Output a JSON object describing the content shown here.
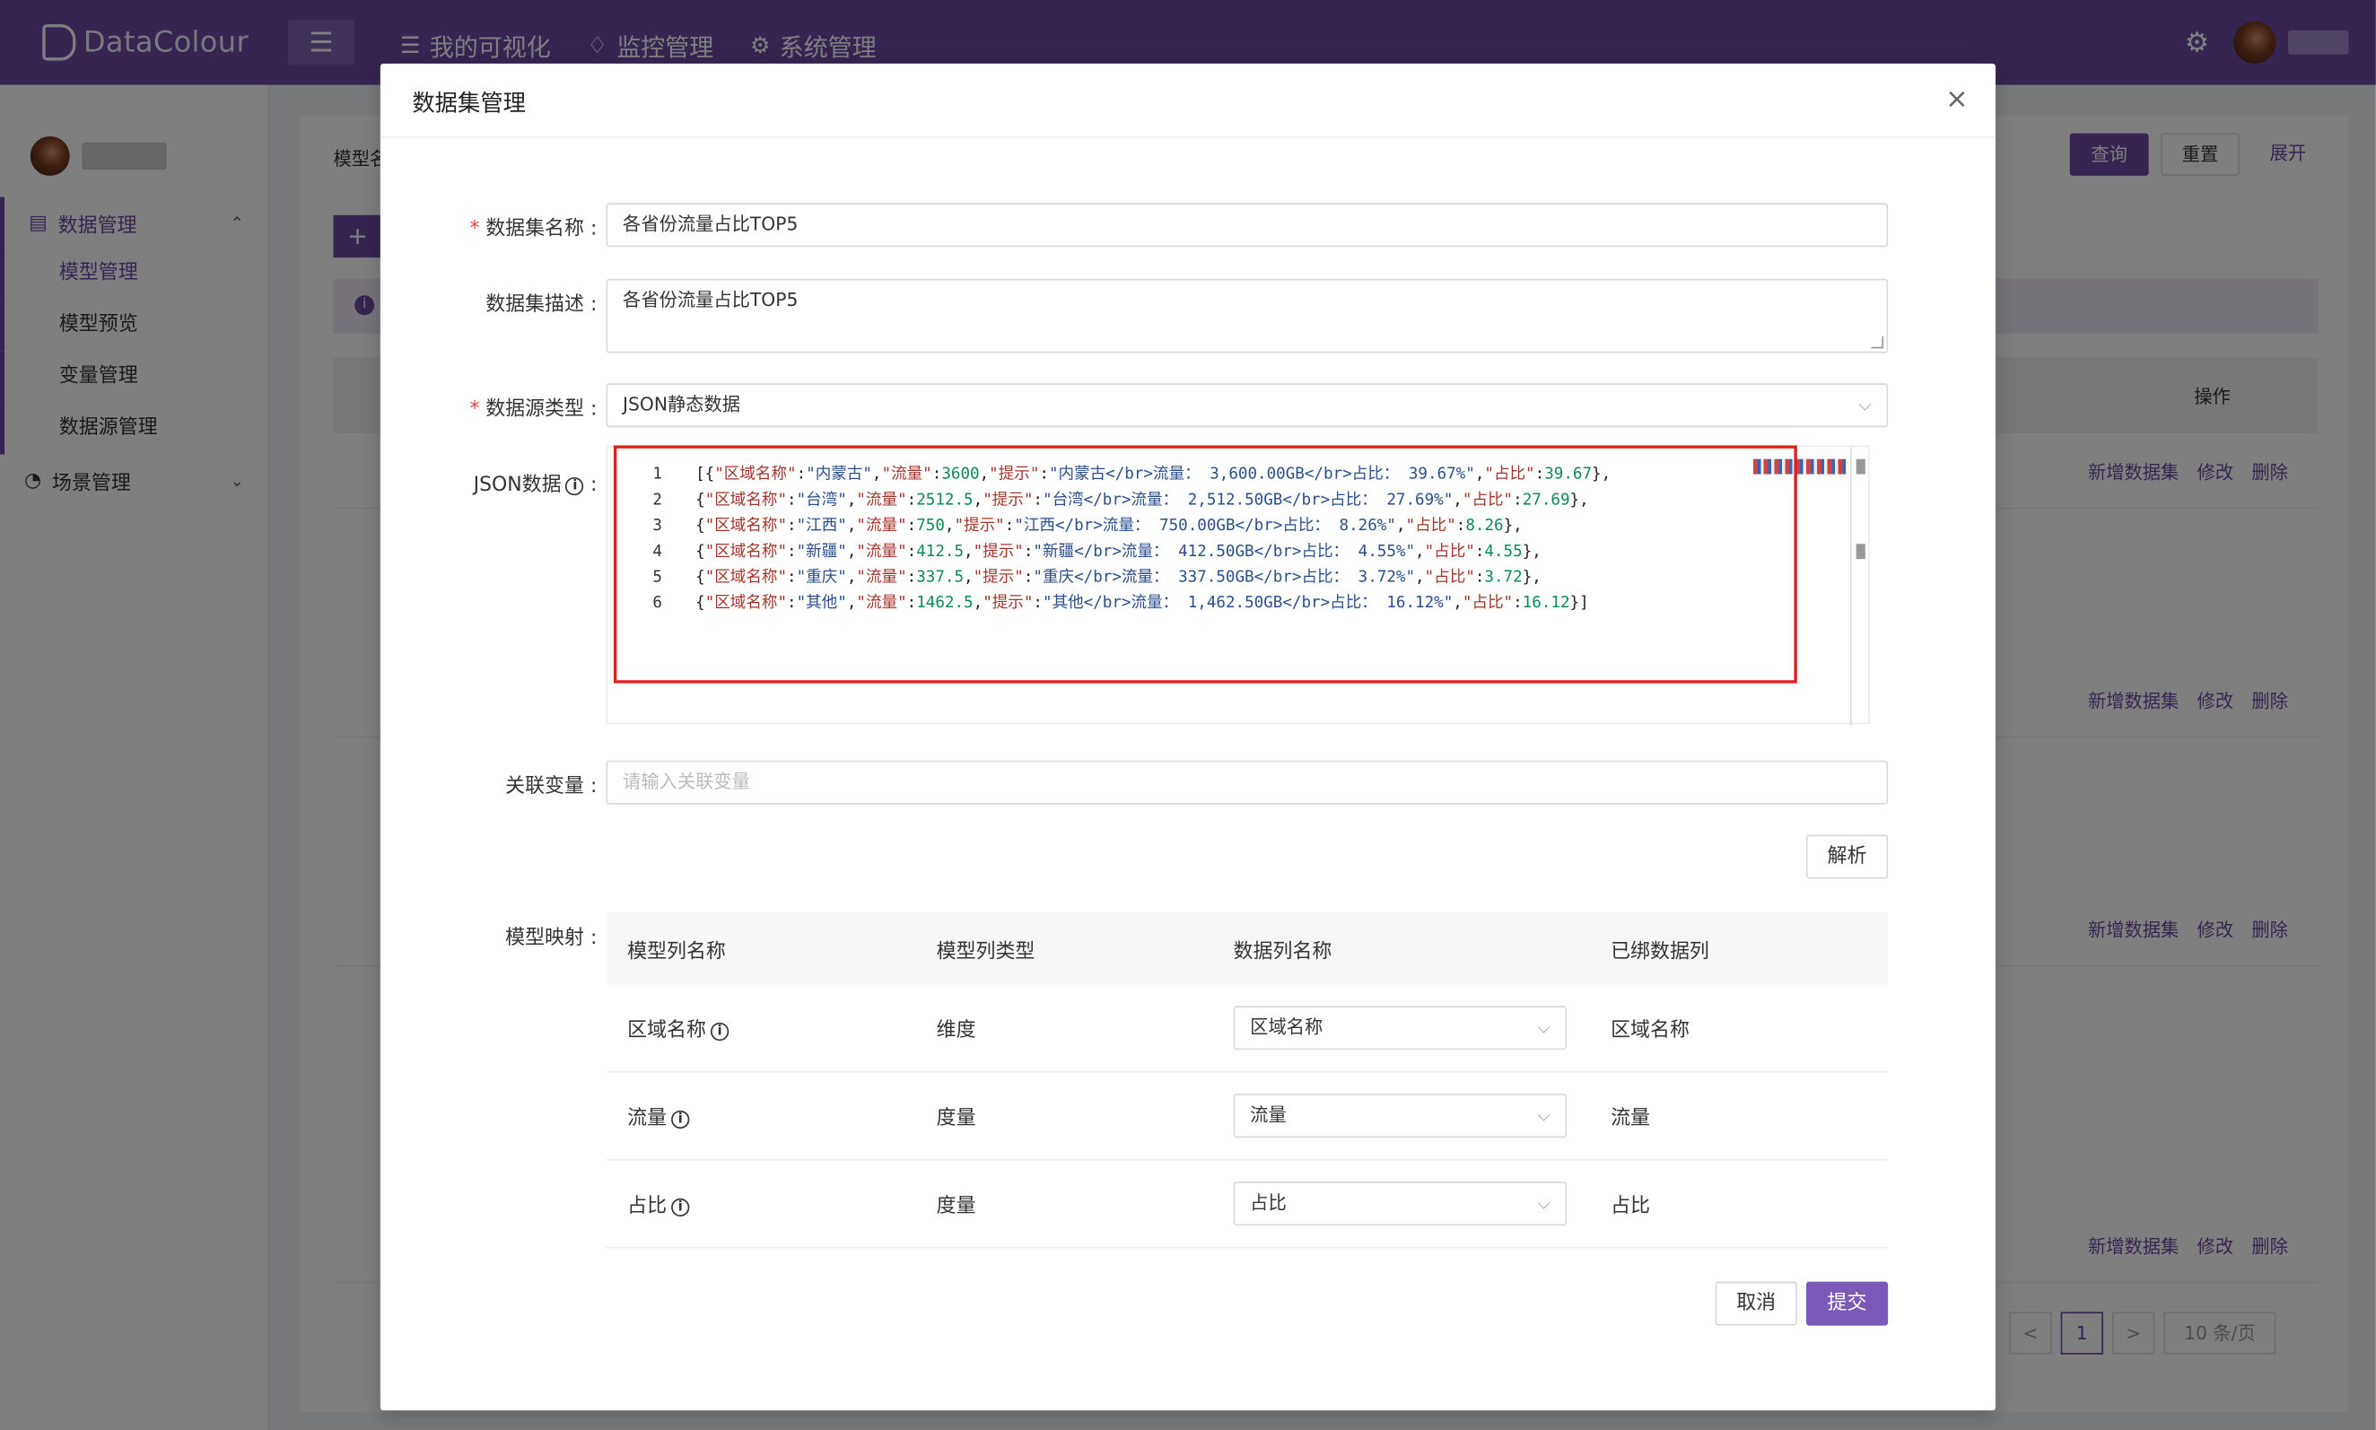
{
  "app": {
    "logo_text": "DataColour"
  },
  "topnav": {
    "collapse_icon": "☰",
    "items": [
      {
        "label": "我的可视化",
        "icon": "list-icon"
      },
      {
        "label": "监控管理",
        "icon": "bell-icon"
      },
      {
        "label": "系统管理",
        "icon": "gear-icon"
      }
    ]
  },
  "sidebar": {
    "group_data": "数据管理",
    "items": [
      "模型管理",
      "模型预览",
      "变量管理",
      "数据源管理"
    ],
    "group_scene": "场景管理"
  },
  "background": {
    "label": "模型名",
    "buttons": {
      "query": "查询",
      "reset": "重置",
      "expand": "展开"
    },
    "ops_header": "操作",
    "ops": {
      "add": "新增数据集",
      "edit": "修改",
      "delete": "删除"
    },
    "pager": {
      "prev": "<",
      "page": "1",
      "next": ">",
      "size": "10 条/页"
    }
  },
  "modal": {
    "title": "数据集管理",
    "close": "×",
    "fields": {
      "name_label": "数据集名称 :",
      "name_value": "各省份流量占比TOP5",
      "desc_label": "数据集描述 :",
      "desc_value": "各省份流量占比TOP5",
      "source_label": "数据源类型 :",
      "source_value": "JSON静态数据",
      "json_label": "JSON数据",
      "var_label": "关联变量 :",
      "var_placeholder": "请输入关联变量",
      "mapping_label": "模型映射 :"
    },
    "json_lines": [
      {
        "open": "[{",
        "name": "内蒙古",
        "flow": "3600",
        "tip_flow": "3,600.00GB",
        "tip_pct": "39.67%",
        "pct": "39.67",
        "close": "},"
      },
      {
        "open": "{",
        "name": "台湾",
        "flow": "2512.5",
        "tip_flow": "2,512.50GB",
        "tip_pct": "27.69%",
        "pct": "27.69",
        "close": "},"
      },
      {
        "open": "{",
        "name": "江西",
        "flow": "750",
        "tip_flow": "750.00GB",
        "tip_pct": "8.26%",
        "pct": "8.26",
        "close": "},"
      },
      {
        "open": "{",
        "name": "新疆",
        "flow": "412.5",
        "tip_flow": "412.50GB",
        "tip_pct": "4.55%",
        "pct": "4.55",
        "close": "},"
      },
      {
        "open": "{",
        "name": "重庆",
        "flow": "337.5",
        "tip_flow": "337.50GB",
        "tip_pct": "3.72%",
        "pct": "3.72",
        "close": "},"
      },
      {
        "open": "{",
        "name": "其他",
        "flow": "1462.5",
        "tip_flow": "1,462.50GB",
        "tip_pct": "16.12%",
        "pct": "16.12",
        "close": "}]"
      }
    ],
    "json_keys": {
      "name": "区域名称",
      "flow": "流量",
      "tip": "提示",
      "pct": "占比",
      "br": "</br>",
      "flow_word": "流量：",
      "pct_word": "占比："
    },
    "parse_button": "解析",
    "mapping": {
      "headers": [
        "模型列名称",
        "模型列类型",
        "数据列名称",
        "已绑数据列"
      ],
      "rows": [
        {
          "name": "区域名称",
          "type": "维度",
          "select": "区域名称",
          "bound": "区域名称"
        },
        {
          "name": "流量",
          "type": "度量",
          "select": "流量",
          "bound": "流量"
        },
        {
          "name": "占比",
          "type": "度量",
          "select": "占比",
          "bound": "占比"
        }
      ]
    },
    "cancel": "取消",
    "submit": "提交"
  },
  "colors": {
    "brand": "#6b4aa1",
    "highlight_box": "#e02020"
  }
}
